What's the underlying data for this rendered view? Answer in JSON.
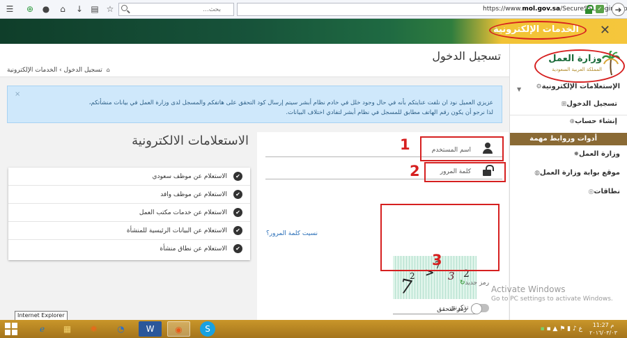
{
  "browser": {
    "url_prefix": "https://www.",
    "url_domain": "mol.gov.sa",
    "url_path": "/SecureSSL/Login.aspx",
    "search_placeholder": "بحث..."
  },
  "banner": {
    "title": "الخدمات الإلكترونية",
    "close": "✕"
  },
  "sidebar": {
    "logo_title": "وزارة العمل",
    "logo_subtitle": "المملكة العربية السعودية",
    "items": [
      {
        "label": "الإستعلامات الإلكترونية"
      },
      {
        "label": "تسجيل الدخول"
      },
      {
        "label": "إنشاء حساب"
      }
    ],
    "tools_header": "أدوات وروابط مهمة",
    "tools": [
      {
        "label": "وزارة العمل"
      },
      {
        "label": "موقع بوابة وزارة العمل"
      },
      {
        "label": "نطاقات"
      }
    ]
  },
  "page": {
    "title": "تسجيل الدخول",
    "breadcrumb_current": "تسجيل الدخول",
    "breadcrumb_parent": "الخدمات الإلكترونية",
    "breadcrumb_sep": "›"
  },
  "alert": {
    "line1": "عزيزي العميل نود ان نلفت عنايتكم بأنه في حال وجود خلل في خادم نظام أبشر سيتم إرسال كود التحقق على هاتفكم والمسجل لدى وزارة العمل في بيانات منشأتكم،",
    "line2": "لذا نرجو أن يكون رقم الهاتف مطابق للمسجل في نظام أبشر لتفادي اختلاف البيانات.",
    "dismiss": "×"
  },
  "login": {
    "username_placeholder": "اسم المستخدم",
    "password_placeholder": "كلمة المرور",
    "forgot_password": "نسيت كلمة المرور؟",
    "captcha_label": "رمز التحقق",
    "captcha_chars": [
      "7",
      "2",
      ">",
      "7",
      "3",
      "2"
    ],
    "new_code": "رمز جديد",
    "new_code_icon": "↻",
    "remember_me": "تذكرني",
    "annotations": [
      "1",
      "2",
      "3"
    ]
  },
  "enquiries": {
    "title": "الاستعلامات الالكترونية",
    "items": [
      {
        "label": "الاستعلام عن موظف سعودي"
      },
      {
        "label": "الاستعلام عن موظف وافد"
      },
      {
        "label": "الاستعلام عن خدمات مكتب العمل"
      },
      {
        "label": "الاستعلام عن البيانات الرئيسية للمنشأة"
      },
      {
        "label": "الاستعلام عن نطاق منشأة"
      }
    ]
  },
  "watermark": {
    "line1": "Activate Windows",
    "line2": "Go to PC settings to activate Windows."
  },
  "taskbar": {
    "tooltip": "Internet Explorer",
    "tray_lang": "ع",
    "time": "11:27 م",
    "date": "٢٠١٦/٠٣/٠٣"
  },
  "colors": {
    "brand_green": "#1b6b3a",
    "tools_brown": "#8a6a35",
    "annotation_red": "#d62020",
    "alert_bg": "#cfe8fb"
  }
}
